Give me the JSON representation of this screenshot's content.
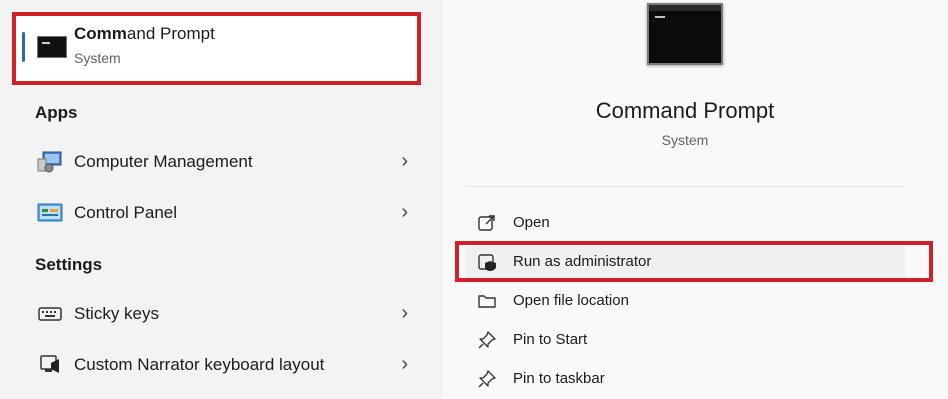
{
  "best_match": {
    "title_bold": "Comm",
    "title_rest": "and Prompt",
    "subtitle": "System"
  },
  "apps": {
    "heading": "Apps",
    "items": [
      {
        "label": "Computer Management",
        "icon": "computer-management-icon",
        "chevron": "›"
      },
      {
        "label": "Control Panel",
        "icon": "control-panel-icon",
        "chevron": "›"
      }
    ]
  },
  "settings": {
    "heading": "Settings",
    "items": [
      {
        "label": "Sticky keys",
        "icon": "keyboard-icon",
        "chevron": "›"
      },
      {
        "label": "Custom Narrator keyboard layout",
        "icon": "narrator-icon",
        "chevron": "›"
      }
    ]
  },
  "detail": {
    "title": "Command Prompt",
    "subtitle": "System",
    "actions": [
      {
        "label": "Open",
        "icon": "open-external-icon"
      },
      {
        "label": "Run as administrator",
        "icon": "shield-admin-icon"
      },
      {
        "label": "Open file location",
        "icon": "folder-icon"
      },
      {
        "label": "Pin to Start",
        "icon": "pin-icon"
      },
      {
        "label": "Pin to taskbar",
        "icon": "pin-icon"
      }
    ]
  },
  "colors": {
    "highlight_border": "#d0202a",
    "accent": "#2c6e9a"
  }
}
